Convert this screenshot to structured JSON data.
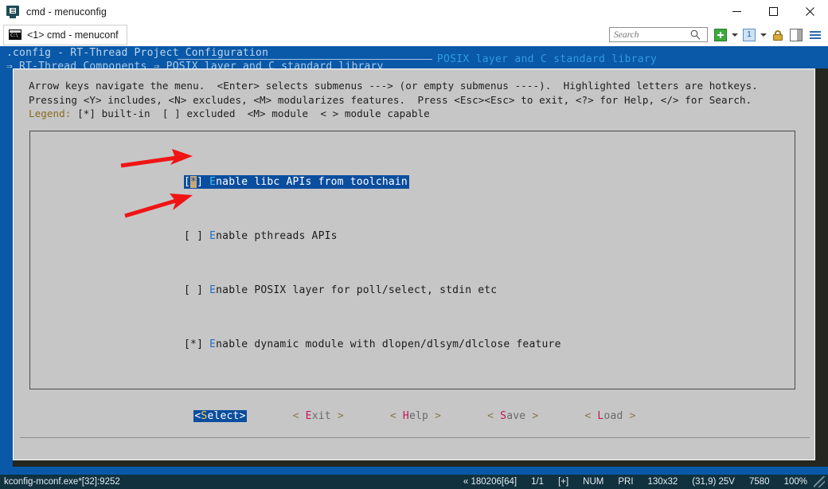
{
  "window": {
    "title": "cmd - menuconfig",
    "icon": "console-monitor-icon",
    "minimize": "—",
    "maximize": "□",
    "close": "✕"
  },
  "tab": {
    "label": "<1> cmd - menuconf",
    "icon_text": "C:\\",
    "icon": "console-icon"
  },
  "toolbar": {
    "search_placeholder": "Search",
    "search_value": "",
    "search_icon": "search-icon",
    "new_tab_icon": "green-plus-icon",
    "new_tab_caret": "chevron-down-icon",
    "panel_icon_label": "1",
    "panel_caret": "chevron-down-icon",
    "lock_icon": "lock-icon",
    "split_icon": "split-panel-icon",
    "menu_icon": "hamburger-menu-icon"
  },
  "menuconfig": {
    "config_line": ".config - RT-Thread Project Configuration",
    "breadcrumb": "⇒ RT-Thread Components ⇒ POSIX layer and C standard library",
    "dialog_title": "POSIX layer and C standard library",
    "help_line1": "Arrow keys navigate the menu.  <Enter> selects submenus ---> (or empty submenus ----).  Highlighted letters are hotkeys.",
    "help_line2": "Pressing <Y> includes, <N> excludes, <M> modularizes features.  Press <Esc><Esc> to exit, <?> for Help, </> for Search.",
    "legend_prefix": "Legend: ",
    "legend_builtin": "[*] built-in ",
    "legend_excluded": " [ ] excluded ",
    "legend_module": " <M> module ",
    "legend_capable": " < > module capable",
    "items": [
      {
        "marker_open": "[",
        "marker_state": "*",
        "marker_close": "]",
        "hotkey": "E",
        "label": "nable libc APIs from toolchain",
        "selected": true,
        "checked": true
      },
      {
        "marker_open": "[",
        "marker_state": " ",
        "marker_close": "]",
        "hotkey": "E",
        "label": "nable pthreads APIs",
        "selected": false,
        "checked": false
      },
      {
        "marker_open": "[",
        "marker_state": " ",
        "marker_close": "]",
        "hotkey": "E",
        "label": "nable POSIX layer for poll/select, stdin etc",
        "selected": false,
        "checked": false
      },
      {
        "marker_open": "[",
        "marker_state": "*",
        "marker_close": "]",
        "hotkey": "E",
        "label": "nable dynamic module with dlopen/dlsym/dlclose feature",
        "selected": false,
        "checked": true
      }
    ],
    "buttons": [
      {
        "open": "<",
        "hotkey": "S",
        "rest": "elect",
        "close": ">",
        "active": true
      },
      {
        "open": "< ",
        "hotkey": "E",
        "rest": "xit",
        "close": " >",
        "active": false
      },
      {
        "open": "< ",
        "hotkey": "H",
        "rest": "elp",
        "close": " >",
        "active": false
      },
      {
        "open": "< ",
        "hotkey": "S",
        "rest": "ave",
        "close": " >",
        "active": false
      },
      {
        "open": "< ",
        "hotkey": "L",
        "rest": "oad",
        "close": " >",
        "active": false
      }
    ]
  },
  "statusbar": {
    "process": "kconfig-mconf.exe*[32]:9252",
    "cells": [
      "« 180206[64]",
      "1/1",
      "[+]",
      "NUM",
      "PRI",
      "130x32",
      "(31,9) 25V",
      "7580",
      "100%"
    ]
  },
  "colors": {
    "console_blue": "#0a58a8",
    "dialog_gray": "#c6c6c6",
    "highlight_blue": "#0b4d9e",
    "cursor_tan": "#c9a878",
    "hotkey_blue": "#1f6fc4",
    "hotkey_red": "#c2185b",
    "arrow_red": "#f01414",
    "status_dark": "#11313f"
  }
}
